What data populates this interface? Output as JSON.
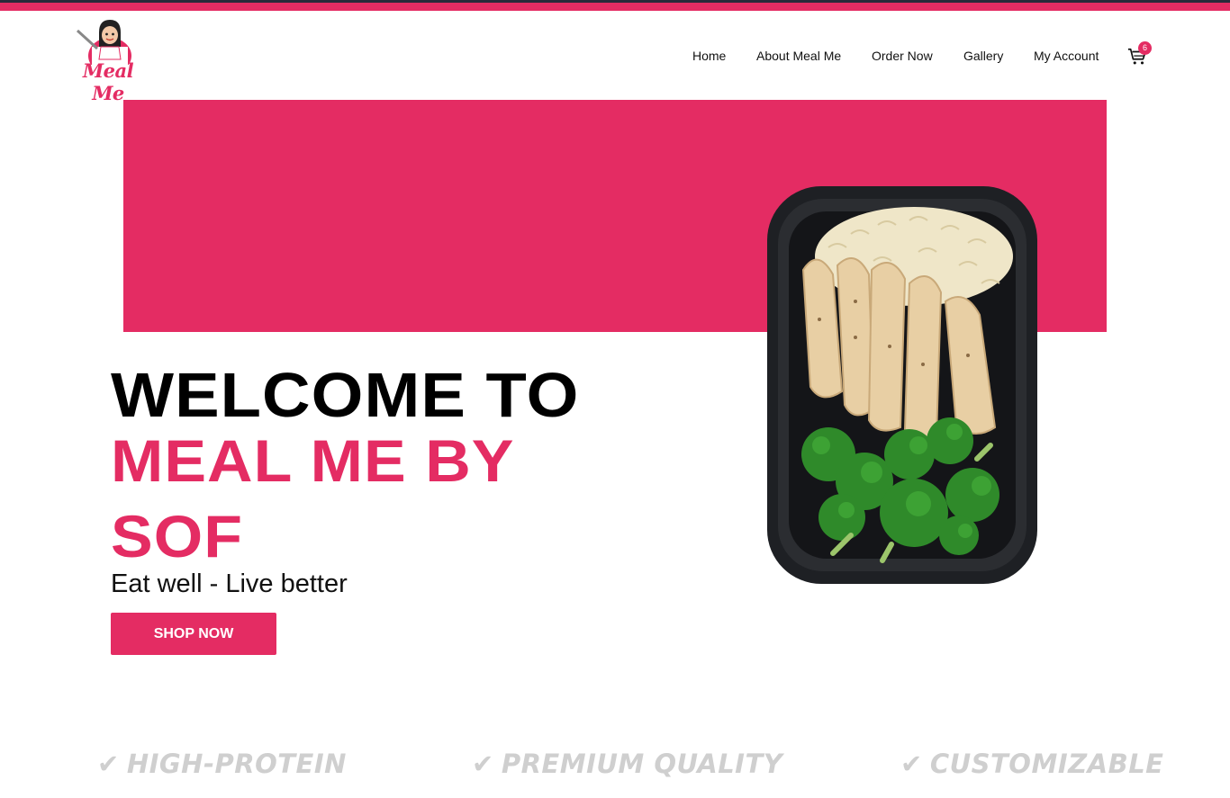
{
  "brand": {
    "logo_text": "Meal Me",
    "accent": "#e42c63"
  },
  "nav": {
    "items": [
      {
        "label": "Home"
      },
      {
        "label": "About Meal Me"
      },
      {
        "label": "Order Now"
      },
      {
        "label": "Gallery"
      },
      {
        "label": "My Account"
      }
    ],
    "cart": {
      "icon": "cart-icon",
      "count": "6"
    }
  },
  "hero": {
    "heading_line1": "WELCOME TO",
    "heading_line2": "MEAL ME BY SOF",
    "tagline": "Eat well - Live better",
    "cta_label": "SHOP NOW"
  },
  "features": [
    {
      "icon": "check-icon",
      "label": "HIGH-PROTEIN"
    },
    {
      "icon": "check-icon",
      "label": "PREMIUM QUALITY"
    },
    {
      "icon": "check-icon",
      "label": "CUSTOMIZABLE"
    }
  ]
}
